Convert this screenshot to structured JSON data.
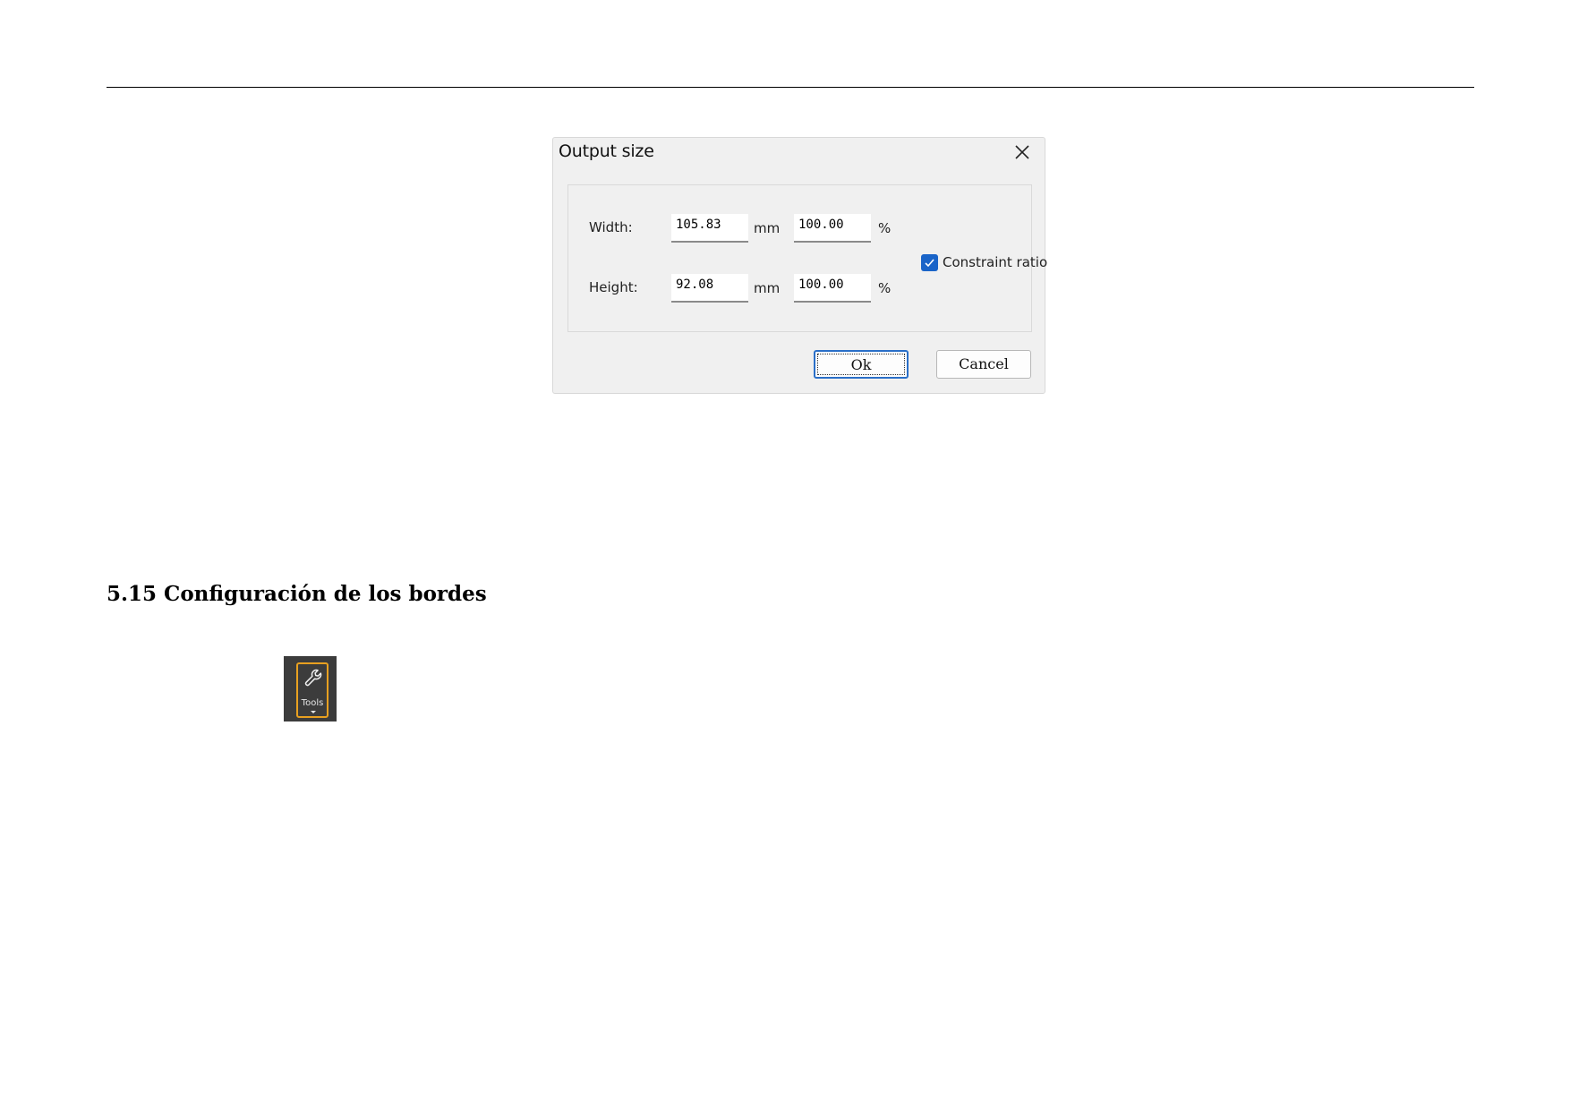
{
  "dialog": {
    "title": "Output size",
    "width_label": "Width:",
    "width_value": "105.83",
    "width_unit": "mm",
    "width_percent": "100.00",
    "width_percent_sign": "%",
    "height_label": "Height:",
    "height_value": "92.08",
    "height_unit": "mm",
    "height_percent": "100.00",
    "height_percent_sign": "%",
    "constraint_label": "Constraint ratio",
    "constraint_checked": true,
    "ok_label": "Ok",
    "cancel_label": "Cancel"
  },
  "section": {
    "heading": "5.15 Configuración de los bordes"
  },
  "tools_button": {
    "label": "Tools",
    "icon": "wrench-icon",
    "accent": "#e8a020"
  }
}
